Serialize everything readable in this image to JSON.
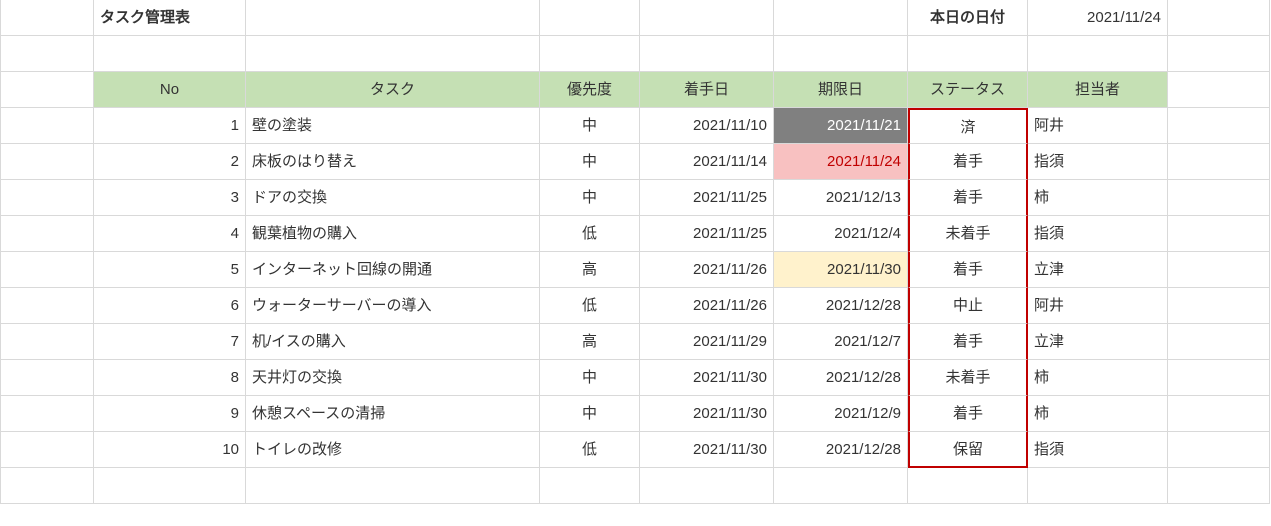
{
  "title": "タスク管理表",
  "today_label": "本日の日付",
  "today_value": "2021/11/24",
  "headers": {
    "no": "No",
    "task": "タスク",
    "priority": "優先度",
    "start": "着手日",
    "due": "期限日",
    "status": "ステータス",
    "assignee": "担当者"
  },
  "rows": [
    {
      "no": "1",
      "task": "壁の塗装",
      "priority": "中",
      "start": "2021/11/10",
      "due": "2021/11/21",
      "due_hl": "gray",
      "status": "済",
      "assignee": "阿井"
    },
    {
      "no": "2",
      "task": "床板のはり替え",
      "priority": "中",
      "start": "2021/11/14",
      "due": "2021/11/24",
      "due_hl": "pink",
      "status": "着手",
      "assignee": "指須"
    },
    {
      "no": "3",
      "task": "ドアの交換",
      "priority": "中",
      "start": "2021/11/25",
      "due": "2021/12/13",
      "due_hl": "",
      "status": "着手",
      "assignee": "柿"
    },
    {
      "no": "4",
      "task": "観葉植物の購入",
      "priority": "低",
      "start": "2021/11/25",
      "due": "2021/12/4",
      "due_hl": "",
      "status": "未着手",
      "assignee": "指須"
    },
    {
      "no": "5",
      "task": "インターネット回線の開通",
      "priority": "高",
      "start": "2021/11/26",
      "due": "2021/11/30",
      "due_hl": "yellow",
      "status": "着手",
      "assignee": "立津"
    },
    {
      "no": "6",
      "task": "ウォーターサーバーの導入",
      "priority": "低",
      "start": "2021/11/26",
      "due": "2021/12/28",
      "due_hl": "",
      "status": "中止",
      "assignee": "阿井"
    },
    {
      "no": "7",
      "task": "机/イスの購入",
      "priority": "高",
      "start": "2021/11/29",
      "due": "2021/12/7",
      "due_hl": "",
      "status": "着手",
      "assignee": "立津"
    },
    {
      "no": "8",
      "task": "天井灯の交換",
      "priority": "中",
      "start": "2021/11/30",
      "due": "2021/12/28",
      "due_hl": "",
      "status": "未着手",
      "assignee": "柿"
    },
    {
      "no": "9",
      "task": "休憩スペースの清掃",
      "priority": "中",
      "start": "2021/11/30",
      "due": "2021/12/9",
      "due_hl": "",
      "status": "着手",
      "assignee": "柿"
    },
    {
      "no": "10",
      "task": "トイレの改修",
      "priority": "低",
      "start": "2021/11/30",
      "due": "2021/12/28",
      "due_hl": "",
      "status": "保留",
      "assignee": "指須"
    }
  ]
}
